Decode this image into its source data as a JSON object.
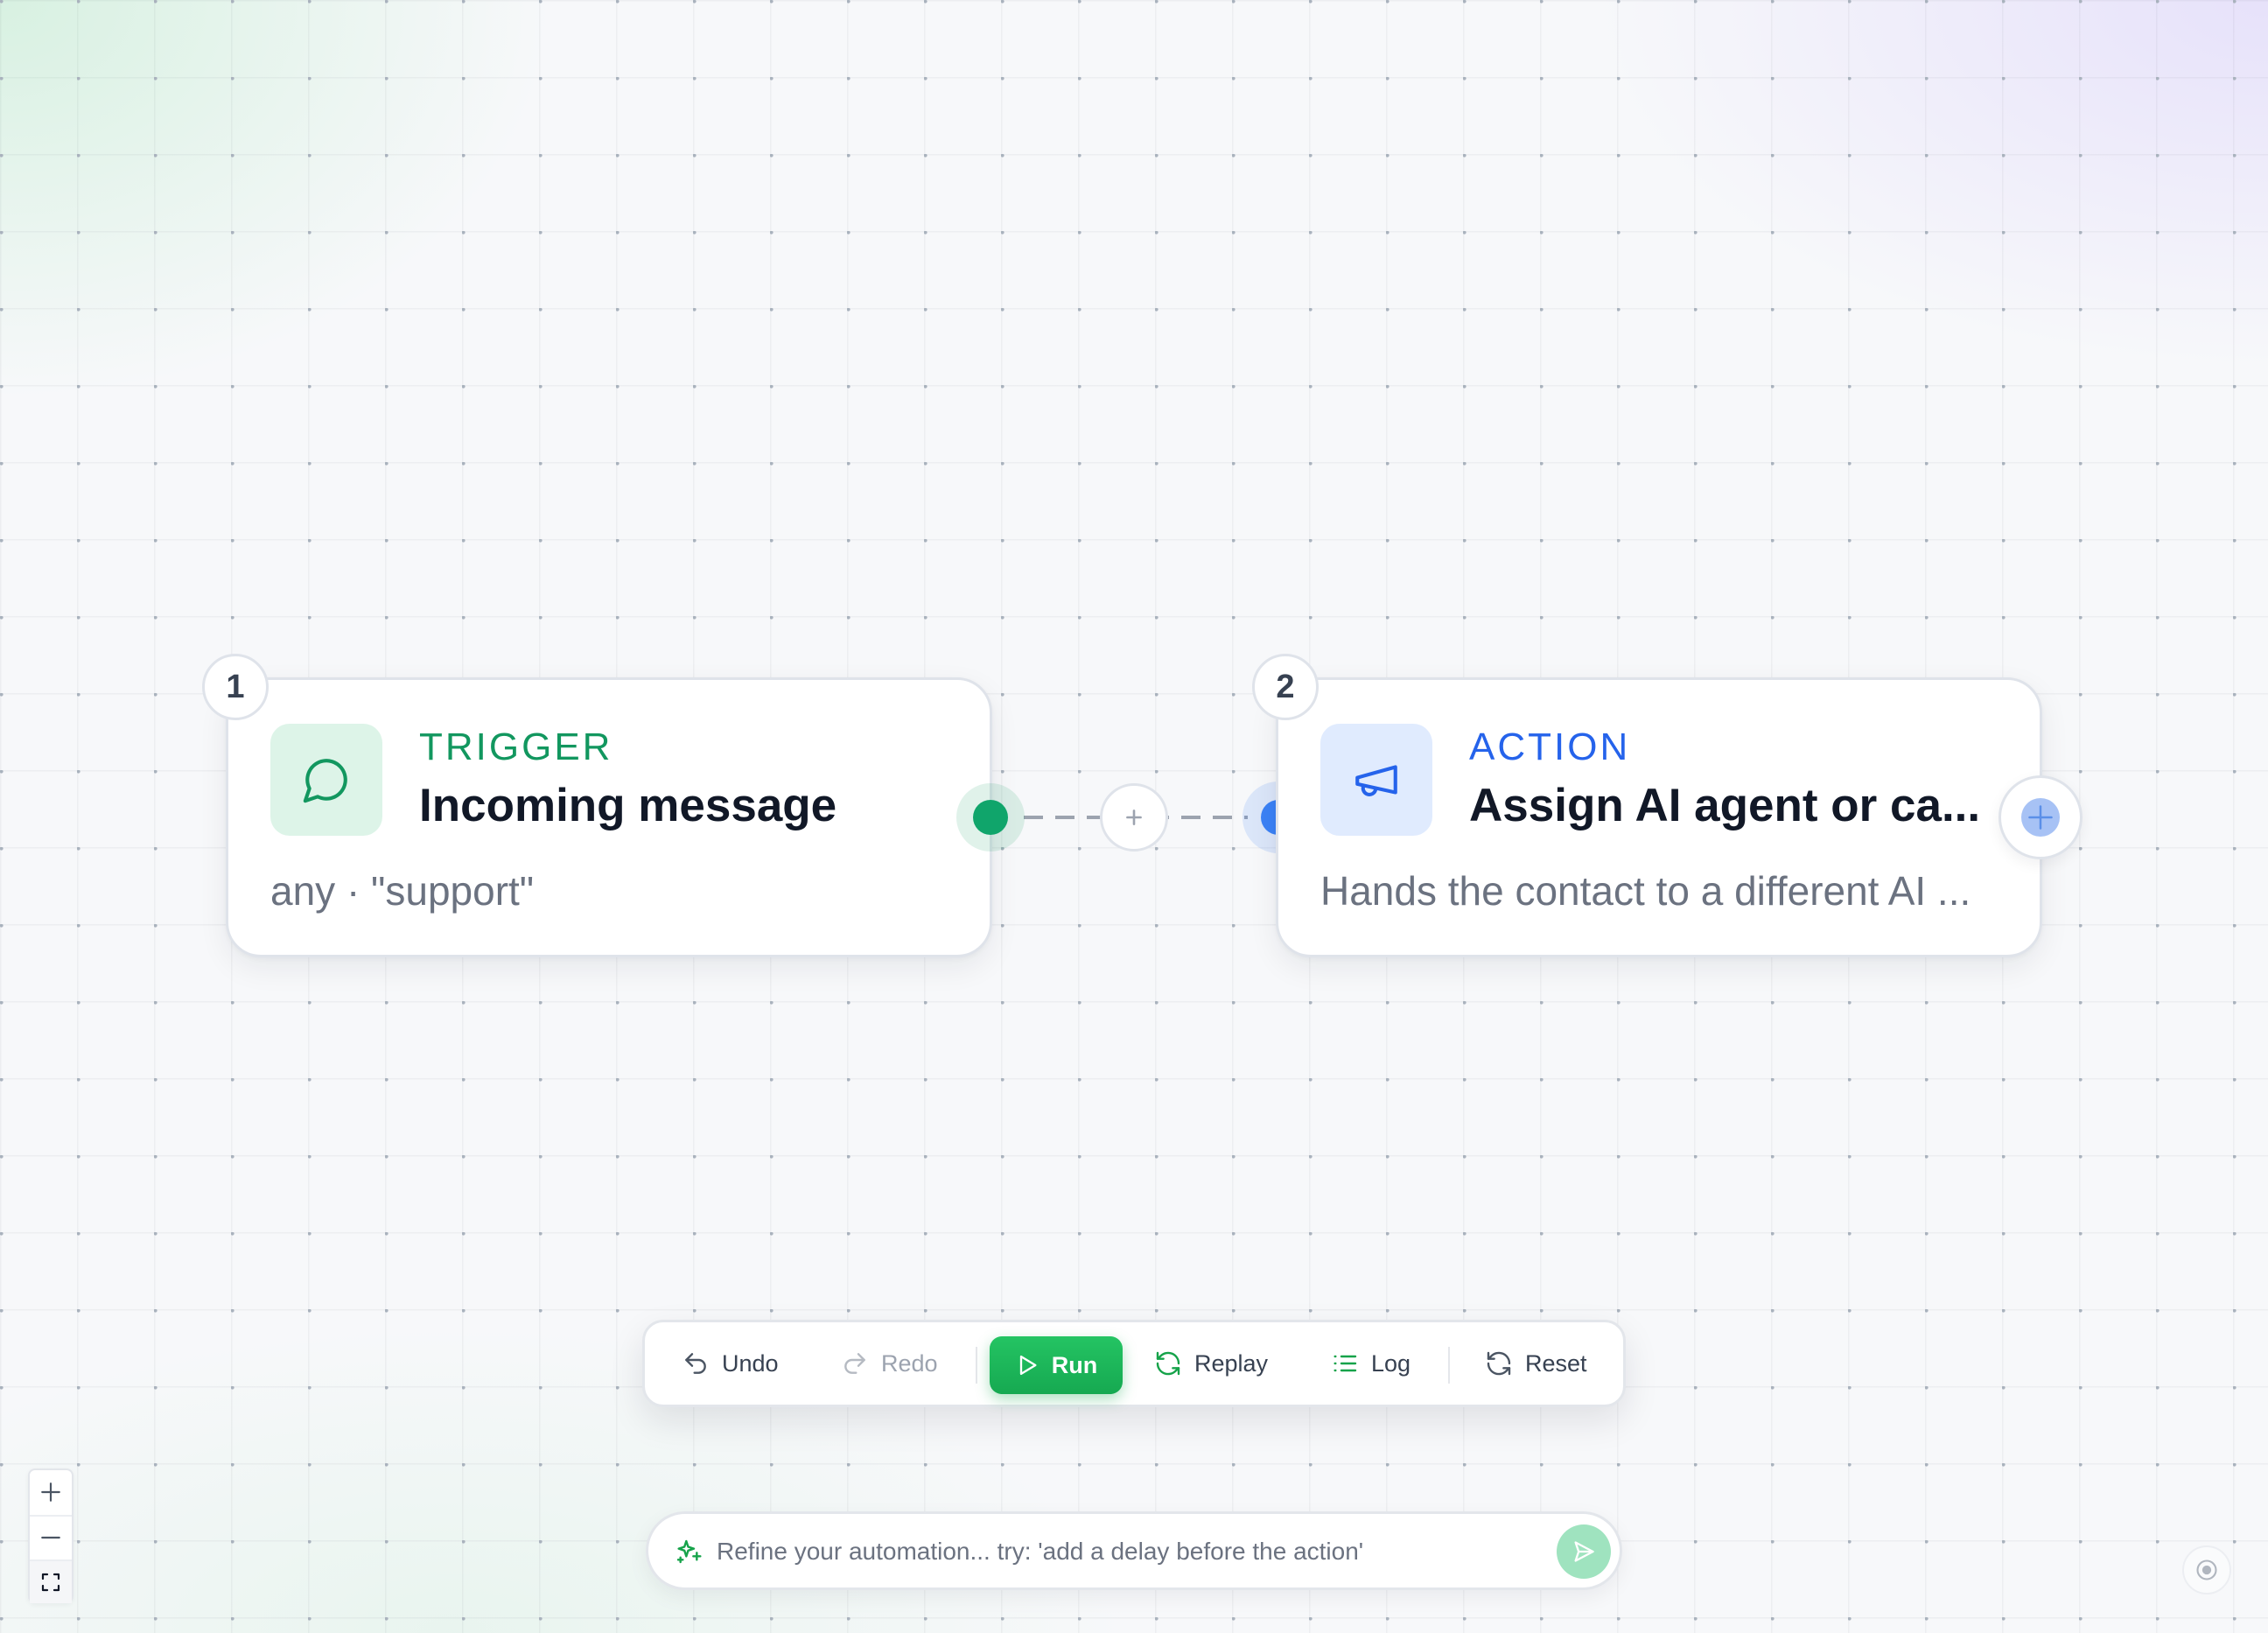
{
  "nodes": [
    {
      "step": "1",
      "kind": "TRIGGER",
      "title": "Incoming message",
      "subtitle": "any · \"support\"",
      "icon": "chat-bubble-icon",
      "color": "#12975f"
    },
    {
      "step": "2",
      "kind": "ACTION",
      "title": "Assign AI agent or ca...",
      "subtitle": "Hands the contact to a different AI ...",
      "icon": "megaphone-icon",
      "color": "#2563eb"
    }
  ],
  "toolbar": {
    "undo": "Undo",
    "redo": "Redo",
    "run": "Run",
    "replay": "Replay",
    "log": "Log",
    "reset": "Reset"
  },
  "prompt": {
    "placeholder": "Refine your automation... try: 'add a delay before the action'",
    "value": ""
  },
  "colors": {
    "run_button": "#1fb85a",
    "trigger_accent": "#12975f",
    "action_accent": "#2563eb"
  }
}
